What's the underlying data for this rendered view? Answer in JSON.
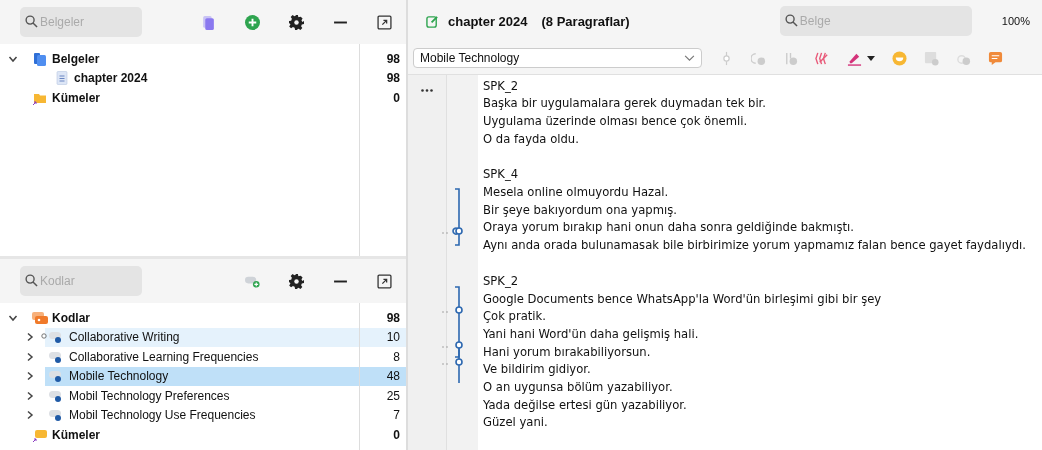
{
  "documents_panel": {
    "search": {
      "placeholder": "Belgeler"
    },
    "tree": [
      {
        "kind": "documents",
        "label": "Belgeler",
        "count": "98",
        "expanded": true,
        "children": [
          {
            "kind": "document",
            "label": "chapter 2024",
            "count": "98"
          }
        ]
      },
      {
        "kind": "sets",
        "label": "Kümeler",
        "count": "0"
      }
    ]
  },
  "codes_panel": {
    "search": {
      "placeholder": "Kodlar"
    },
    "root": {
      "label": "Kodlar",
      "count": "98",
      "expanded": true
    },
    "codes": [
      {
        "label": "Collaborative Writing",
        "count": "10",
        "selected": false,
        "hovered": true,
        "color": "#1f5aa6"
      },
      {
        "label": "Collaborative Learning Frequencies",
        "count": "8",
        "selected": false,
        "hovered": false,
        "color": "#1f5aa6"
      },
      {
        "label": "Mobile Technology",
        "count": "48",
        "selected": true,
        "hovered": false,
        "color": "#1f5aa6"
      },
      {
        "label": "Mobil Technology Preferences",
        "count": "25",
        "selected": false,
        "hovered": false,
        "color": "#1f5aa6"
      },
      {
        "label": "Mobil Technology Use Frequencies",
        "count": "7",
        "selected": false,
        "hovered": false,
        "color": "#1f5aa6"
      }
    ],
    "sets": {
      "label": "Kümeler",
      "count": "0"
    }
  },
  "document_view": {
    "title": "chapter 2024",
    "subtitle": "(8 Paragraflar)",
    "search": {
      "placeholder": "Belge"
    },
    "zoom": "100%",
    "code_dropdown": {
      "value": "Mobile Technology"
    },
    "paragraphs": [
      {
        "speaker": "SPK_2",
        "lines": [
          "Başka bir uygulamalara gerek duymadan tek bir.",
          "Uygulama üzerinde olması bence çok önemli.",
          "O da fayda oldu."
        ]
      },
      {
        "speaker": "SPK_4",
        "lines": [
          "Mesela online olmuyordu Hazal.",
          "Bir şeye bakıyordum ona yapmış.",
          "Oraya yorum bırakıp hani onun daha sonra geldiğinde bakmıştı.",
          "Aynı anda orada bulunamasak bile birbirimize yorum yapmamız falan bence gayet faydalıydı."
        ]
      },
      {
        "speaker": "SPK_2",
        "lines": [
          "Google Documents bence WhatsApp'la Word'ün birleşimi gibi bir şey",
          "Çok pratik.",
          "Yani hani Word'ün daha gelişmiş hali.",
          "Hani yorum bırakabiliyorsun.",
          "Ve bildirim gidiyor.",
          "O an uygunsa bölüm yazabiliyor.",
          "Yada değilse ertesi gün yazabiliyor.",
          "Güzel yani."
        ]
      }
    ]
  }
}
